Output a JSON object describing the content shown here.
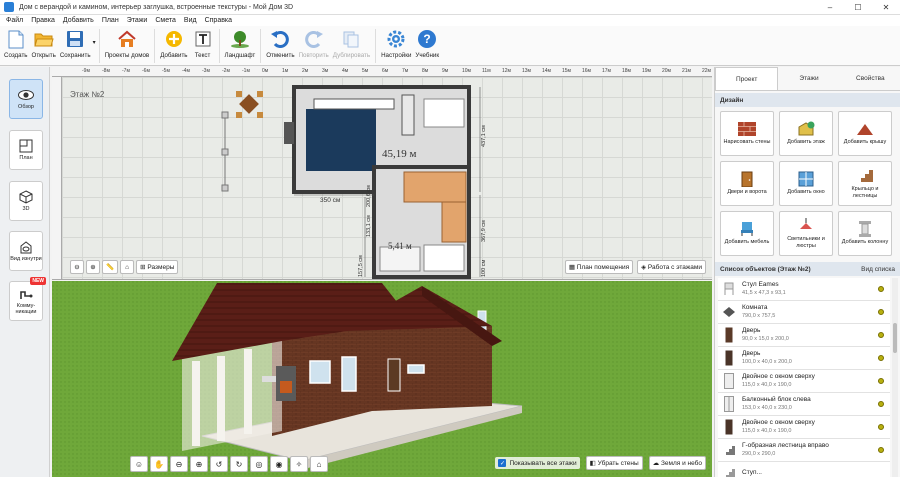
{
  "window": {
    "title": "Дом с верандой и камином, интерьер заглушка, встроенные текстуры - Мой Дом 3D",
    "min": "–",
    "max": "☐",
    "close": "✕"
  },
  "menu": [
    "Файл",
    "Правка",
    "Добавить",
    "План",
    "Этажи",
    "Смета",
    "Вид",
    "Справка"
  ],
  "toolbar": [
    {
      "label": "Создать",
      "icon": "new-document-icon"
    },
    {
      "label": "Открыть",
      "icon": "folder-open-icon"
    },
    {
      "label": "Сохранить",
      "icon": "save-disk-icon"
    },
    {
      "label": "Проекты домов",
      "icon": "house-projects-icon"
    },
    {
      "label": "Добавить",
      "icon": "add-plus-icon"
    },
    {
      "label": "Текст",
      "icon": "text-icon"
    },
    {
      "label": "Ландшафт",
      "icon": "landscape-tree-icon"
    },
    {
      "label": "Отменить",
      "icon": "undo-icon"
    },
    {
      "label": "Повторить",
      "icon": "redo-icon",
      "disabled": true
    },
    {
      "label": "Дублировать",
      "icon": "duplicate-icon",
      "disabled": true
    },
    {
      "label": "Настройки",
      "icon": "settings-gear-icon"
    },
    {
      "label": "Учебник",
      "icon": "help-icon"
    }
  ],
  "leftbar": [
    {
      "label": "Обзор",
      "icon": "eye-icon",
      "active": true
    },
    {
      "label": "План",
      "icon": "plan-icon"
    },
    {
      "label": "3D",
      "icon": "cube-3d-icon"
    },
    {
      "label": "Вид изнутри",
      "icon": "inside-view-icon"
    },
    {
      "label": "Комму-никации",
      "icon": "communications-icon",
      "badge": "NEW"
    }
  ],
  "plan": {
    "floor_label": "Этаж №2",
    "area_big": "45,19 м",
    "area_small": "5,41 м",
    "dims": [
      "350 см",
      "157,5 см",
      "133,1 см",
      "200,6 см",
      "437,1 см",
      "367,9 см",
      "100 см"
    ],
    "ruler_ticks": [
      "-9м",
      "-8м",
      "-7м",
      "-6м",
      "-5м",
      "-4м",
      "-3м",
      "-2м",
      "-1м",
      "0м",
      "1м",
      "2м",
      "3м",
      "4м",
      "5м",
      "6м",
      "7м",
      "8м",
      "9м",
      "10м",
      "11м",
      "12м",
      "13м",
      "14м",
      "15м",
      "16м",
      "17м",
      "18м",
      "19м",
      "20м",
      "21м",
      "22м"
    ],
    "toolbar": {
      "sizes_label": "Размеры"
    },
    "right_buttons": {
      "room_plan": "План помещения",
      "floors": "Работа с этажами"
    }
  },
  "view3d": {
    "show_all_floors": "Показывать все этажи",
    "remove_walls": "Убрать стены",
    "ground_sky": "Земля и небо"
  },
  "right_panel": {
    "tabs": [
      "Проект",
      "Этажи",
      "Свойства"
    ],
    "design_title": "Дизайн",
    "design_buttons": [
      {
        "label": "Нарисовать стены",
        "icon": "brick-wall-icon"
      },
      {
        "label": "Добавить этаж",
        "icon": "add-floor-icon"
      },
      {
        "label": "Добавить крышу",
        "icon": "roof-icon"
      },
      {
        "label": "Двери и ворота",
        "icon": "door-icon"
      },
      {
        "label": "Добавить окно",
        "icon": "window-icon"
      },
      {
        "label": "Крыльцо и лестницы",
        "icon": "stairs-icon"
      },
      {
        "label": "Добавить мебель",
        "icon": "chair-icon"
      },
      {
        "label": "Светильники и люстры",
        "icon": "lamp-icon"
      },
      {
        "label": "Добавить колонну",
        "icon": "column-icon"
      }
    ],
    "objects_title": "Список объектов (Этаж №2)",
    "view_list": "Вид списка",
    "objects": [
      {
        "name": "Стул Eames",
        "size": "41,5 x 47,3 x 93,1",
        "icon": "chair-icon"
      },
      {
        "name": "Комната",
        "size": "790,0 x 757,5",
        "icon": "room-icon"
      },
      {
        "name": "Дверь",
        "size": "90,0 x 15,0 x 200,0",
        "icon": "door-icon"
      },
      {
        "name": "Дверь",
        "size": "100,0 x 40,0 x 200,0",
        "icon": "door-icon"
      },
      {
        "name": "Двойное с окном сверху",
        "size": "115,0 x 40,0 x 190,0",
        "icon": "door-icon"
      },
      {
        "name": "Балконный блок слева",
        "size": "153,0 x 40,0 x 230,0",
        "icon": "balcony-door-icon"
      },
      {
        "name": "Двойное с окном сверху",
        "size": "115,0 x 40,0 x 190,0",
        "icon": "door-icon"
      },
      {
        "name": "Г-образная лестница вправо",
        "size": "290,0 x 290,0",
        "icon": "stairs-icon"
      },
      {
        "name": "Ступ...",
        "size": "",
        "icon": "stairs-icon"
      }
    ]
  }
}
